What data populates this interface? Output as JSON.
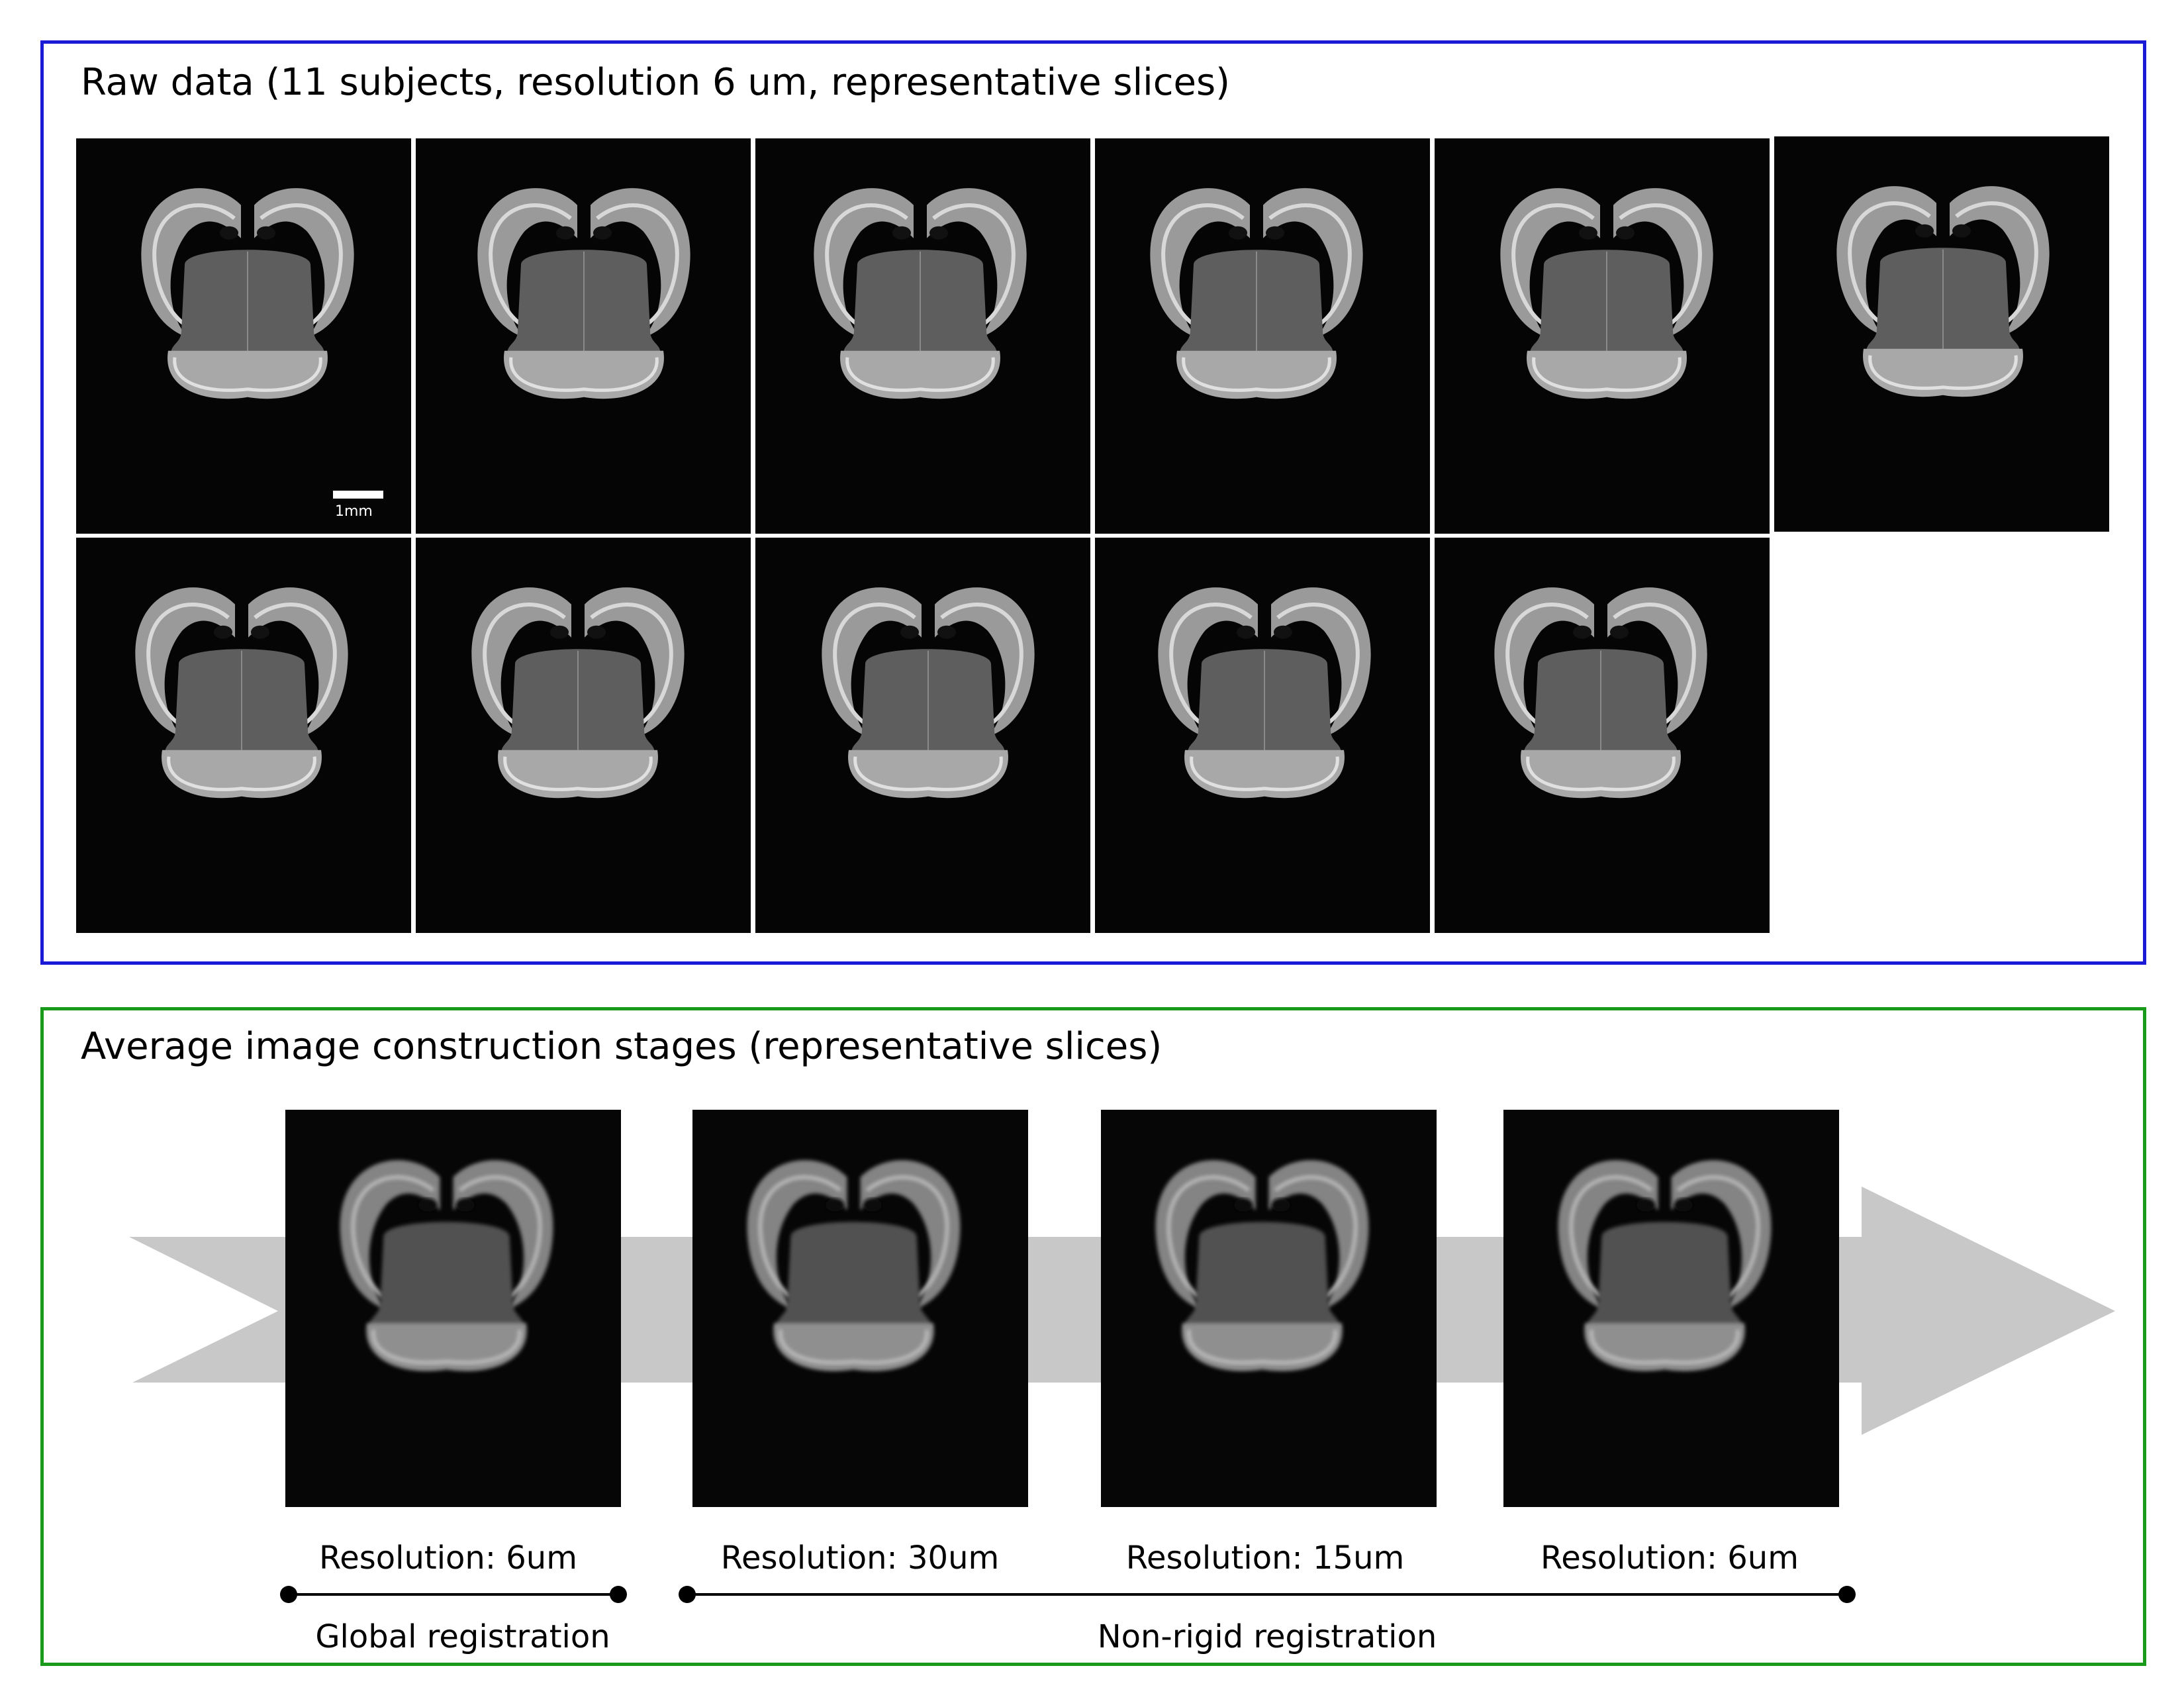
{
  "raw_panel": {
    "title": "Raw data (11 subjects, resolution 6 um, representative slices)",
    "subject_count": 11,
    "scalebar_label": "1mm"
  },
  "avg_panel": {
    "title": "Average image construction stages (representative slices)",
    "stages": [
      {
        "resolution_label": "Resolution: 6um"
      },
      {
        "resolution_label": "Resolution: 30um"
      },
      {
        "resolution_label": "Resolution: 15um"
      },
      {
        "resolution_label": "Resolution: 6um"
      }
    ],
    "registration_groups": [
      {
        "label": "Global registration"
      },
      {
        "label": "Non-rigid registration"
      }
    ]
  },
  "colors": {
    "raw_border": "#1a1ad6",
    "avg_border": "#1a9a1a",
    "arrow": "#c8c8c8",
    "image_background": "#050505"
  }
}
